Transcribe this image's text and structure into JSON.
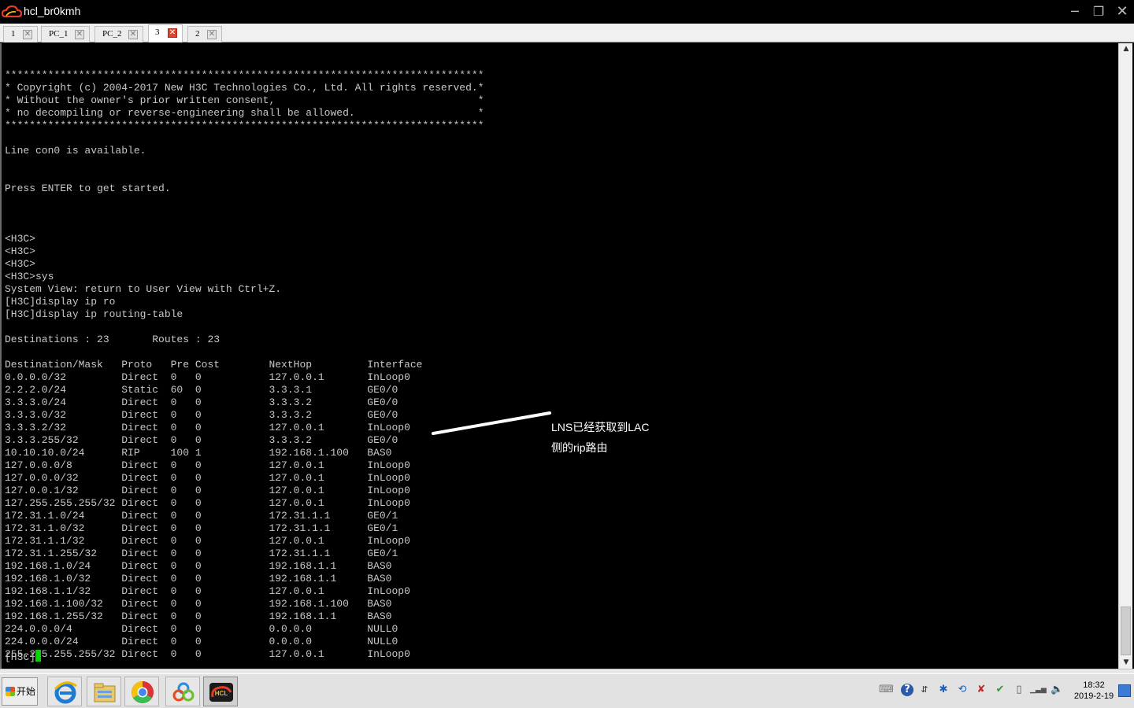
{
  "window": {
    "title": "hcl_br0kmh",
    "min_glyph": "─",
    "max_glyph": "❐",
    "close_glyph": "✕",
    "accent": "#000000"
  },
  "tabs": [
    {
      "label": "1",
      "active": false
    },
    {
      "label": "PC_1",
      "active": false
    },
    {
      "label": "PC_2",
      "active": false
    },
    {
      "label": "3",
      "active": true
    },
    {
      "label": "2",
      "active": false
    }
  ],
  "tab_close_glyph": "✕",
  "terminal": {
    "lines": [
      "******************************************************************************",
      "* Copyright (c) 2004-2017 New H3C Technologies Co., Ltd. All rights reserved.*",
      "* Without the owner's prior written consent,                                 *",
      "* no decompiling or reverse-engineering shall be allowed.                    *",
      "******************************************************************************",
      "",
      "Line con0 is available.",
      "",
      "",
      "Press ENTER to get started.",
      "",
      "",
      "",
      "<H3C>",
      "<H3C>",
      "<H3C>",
      "<H3C>sys",
      "System View: return to User View with Ctrl+Z.",
      "[H3C]display ip ro",
      "[H3C]display ip routing-table",
      "",
      "Destinations : 23       Routes : 23",
      "",
      "Destination/Mask   Proto   Pre Cost        NextHop         Interface",
      "0.0.0.0/32         Direct  0   0           127.0.0.1       InLoop0",
      "2.2.2.0/24         Static  60  0           3.3.3.1         GE0/0",
      "3.3.3.0/24         Direct  0   0           3.3.3.2         GE0/0",
      "3.3.3.0/32         Direct  0   0           3.3.3.2         GE0/0",
      "3.3.3.2/32         Direct  0   0           127.0.0.1       InLoop0",
      "3.3.3.255/32       Direct  0   0           3.3.3.2         GE0/0",
      "10.10.10.0/24      RIP     100 1           192.168.1.100   BAS0",
      "127.0.0.0/8        Direct  0   0           127.0.0.1       InLoop0",
      "127.0.0.0/32       Direct  0   0           127.0.0.1       InLoop0",
      "127.0.0.1/32       Direct  0   0           127.0.0.1       InLoop0",
      "127.255.255.255/32 Direct  0   0           127.0.0.1       InLoop0",
      "172.31.1.0/24      Direct  0   0           172.31.1.1      GE0/1",
      "172.31.1.0/32      Direct  0   0           172.31.1.1      GE0/1",
      "172.31.1.1/32      Direct  0   0           127.0.0.1       InLoop0",
      "172.31.1.255/32    Direct  0   0           172.31.1.1      GE0/1",
      "192.168.1.0/24     Direct  0   0           192.168.1.1     BAS0",
      "192.168.1.0/32     Direct  0   0           192.168.1.1     BAS0",
      "192.168.1.1/32     Direct  0   0           127.0.0.1       InLoop0",
      "192.168.1.100/32   Direct  0   0           192.168.1.100   BAS0",
      "192.168.1.255/32   Direct  0   0           192.168.1.1     BAS0",
      "224.0.0.0/4        Direct  0   0           0.0.0.0         NULL0",
      "224.0.0.0/24       Direct  0   0           0.0.0.0         NULL0",
      "255.255.255.255/32 Direct  0   0           127.0.0.1       InLoop0"
    ],
    "prompt": "[H3C]",
    "cursor_color": "#00d800",
    "text_color": "#c8c8c8",
    "background": "#000000"
  },
  "scrollbar": {
    "up_glyph": "▲",
    "down_glyph": "▼"
  },
  "annotation": {
    "line1": "LNS已经获取到LAC",
    "line2": "侧的rip路由",
    "color": "#ffffff"
  },
  "taskbar": {
    "start_label": "开始",
    "apps": [
      "internet-explorer-icon",
      "file-explorer-icon",
      "chrome-icon",
      "baidu-netdisk-icon",
      "hcl-icon"
    ],
    "hcl_badge": "HCL",
    "tray": {
      "keyboard": "⌨",
      "help": "?",
      "expand": "⇵",
      "bluetooth": "✱",
      "net1": "⟲",
      "net2": "✘",
      "net3": "✔",
      "battery": "▯",
      "signal": "▁▃▅",
      "volume": "🔈"
    },
    "clock_time": "18:32",
    "clock_date": "2019-2-19"
  }
}
